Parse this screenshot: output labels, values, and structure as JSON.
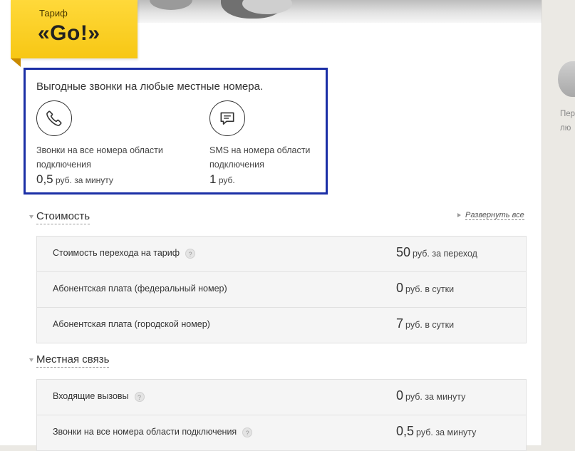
{
  "tariff": {
    "label": "Тариф",
    "name": "«Go!»"
  },
  "promo": {
    "headline": "Выгодные звонки на любые местные номера.",
    "features": [
      {
        "icon": "phone-icon",
        "description": "Звонки на все номера области подключения",
        "price_value": "0,5",
        "price_unit": "руб. за минуту"
      },
      {
        "icon": "sms-icon",
        "description": "SMS на номера области подключения",
        "price_value": "1",
        "price_unit": "руб."
      }
    ]
  },
  "expand_all": "Развернуть все",
  "sections": [
    {
      "title": "Стоимость",
      "rows": [
        {
          "name": "Стоимость перехода на тариф",
          "help": true,
          "value": "50",
          "unit": "руб. за переход"
        },
        {
          "name": "Абонентская плата (федеральный номер)",
          "help": false,
          "value": "0",
          "unit": "руб. в сутки"
        },
        {
          "name": "Абонентская плата (городской номер)",
          "help": false,
          "value": "7",
          "unit": "руб. в сутки"
        }
      ]
    },
    {
      "title": "Местная связь",
      "rows": [
        {
          "name": "Входящие вызовы",
          "help": true,
          "value": "0",
          "unit": "руб. за минуту"
        },
        {
          "name": "Звонки на все номера области подключения",
          "help": true,
          "value": "0,5",
          "unit": "руб. за минуту"
        }
      ]
    }
  ],
  "help_glyph": "?",
  "sidebar": {
    "line1": "Пер",
    "line2": "лю"
  },
  "colors": {
    "ribbon": "#f7c714",
    "promo_border": "#1b2fa6",
    "table_bg": "#f5f5f5"
  }
}
